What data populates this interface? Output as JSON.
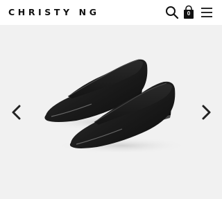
{
  "header": {
    "brand": "CHRISTY NG",
    "icons": {
      "search": "search-icon",
      "bag": "shopping-bag-icon",
      "menu": "hamburger-menu-icon"
    },
    "bag_count": "0"
  },
  "gallery": {
    "icons": {
      "prev": "chevron-left-icon",
      "next": "chevron-right-icon"
    },
    "colors": {
      "background": "#f1f1f1",
      "shoe": "#1a1a1a"
    }
  }
}
